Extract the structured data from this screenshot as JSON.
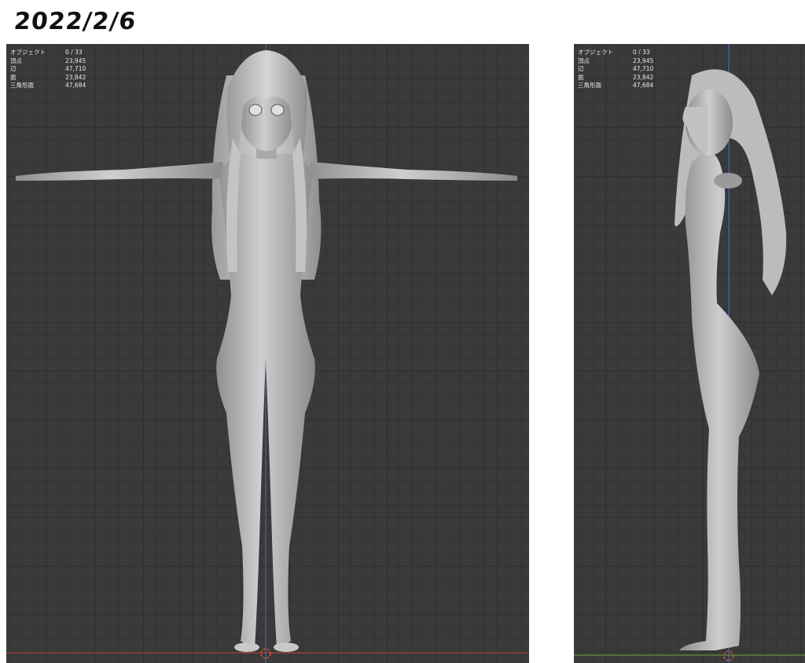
{
  "header": {
    "date": "2022/2/6"
  },
  "stats_labels": {
    "objects": "オブジェクト",
    "vertices": "頂点",
    "edges": "辺",
    "faces": "面",
    "triangles": "三角形面"
  },
  "viewports": [
    {
      "view": "front",
      "stats": {
        "objects": "0 / 33",
        "vertices": "23,945",
        "edges": "47,710",
        "faces": "23,842",
        "triangles": "47,684"
      }
    },
    {
      "view": "side",
      "stats": {
        "objects": "0 / 33",
        "vertices": "23,945",
        "edges": "47,710",
        "faces": "23,842",
        "triangles": "47,684"
      }
    }
  ],
  "colors": {
    "viewport_bg": "#3a3a3a",
    "axis_x": "#c8423e",
    "axis_y": "#6fa33a",
    "axis_z": "#3c74c9",
    "model": "#b9b9b9"
  }
}
